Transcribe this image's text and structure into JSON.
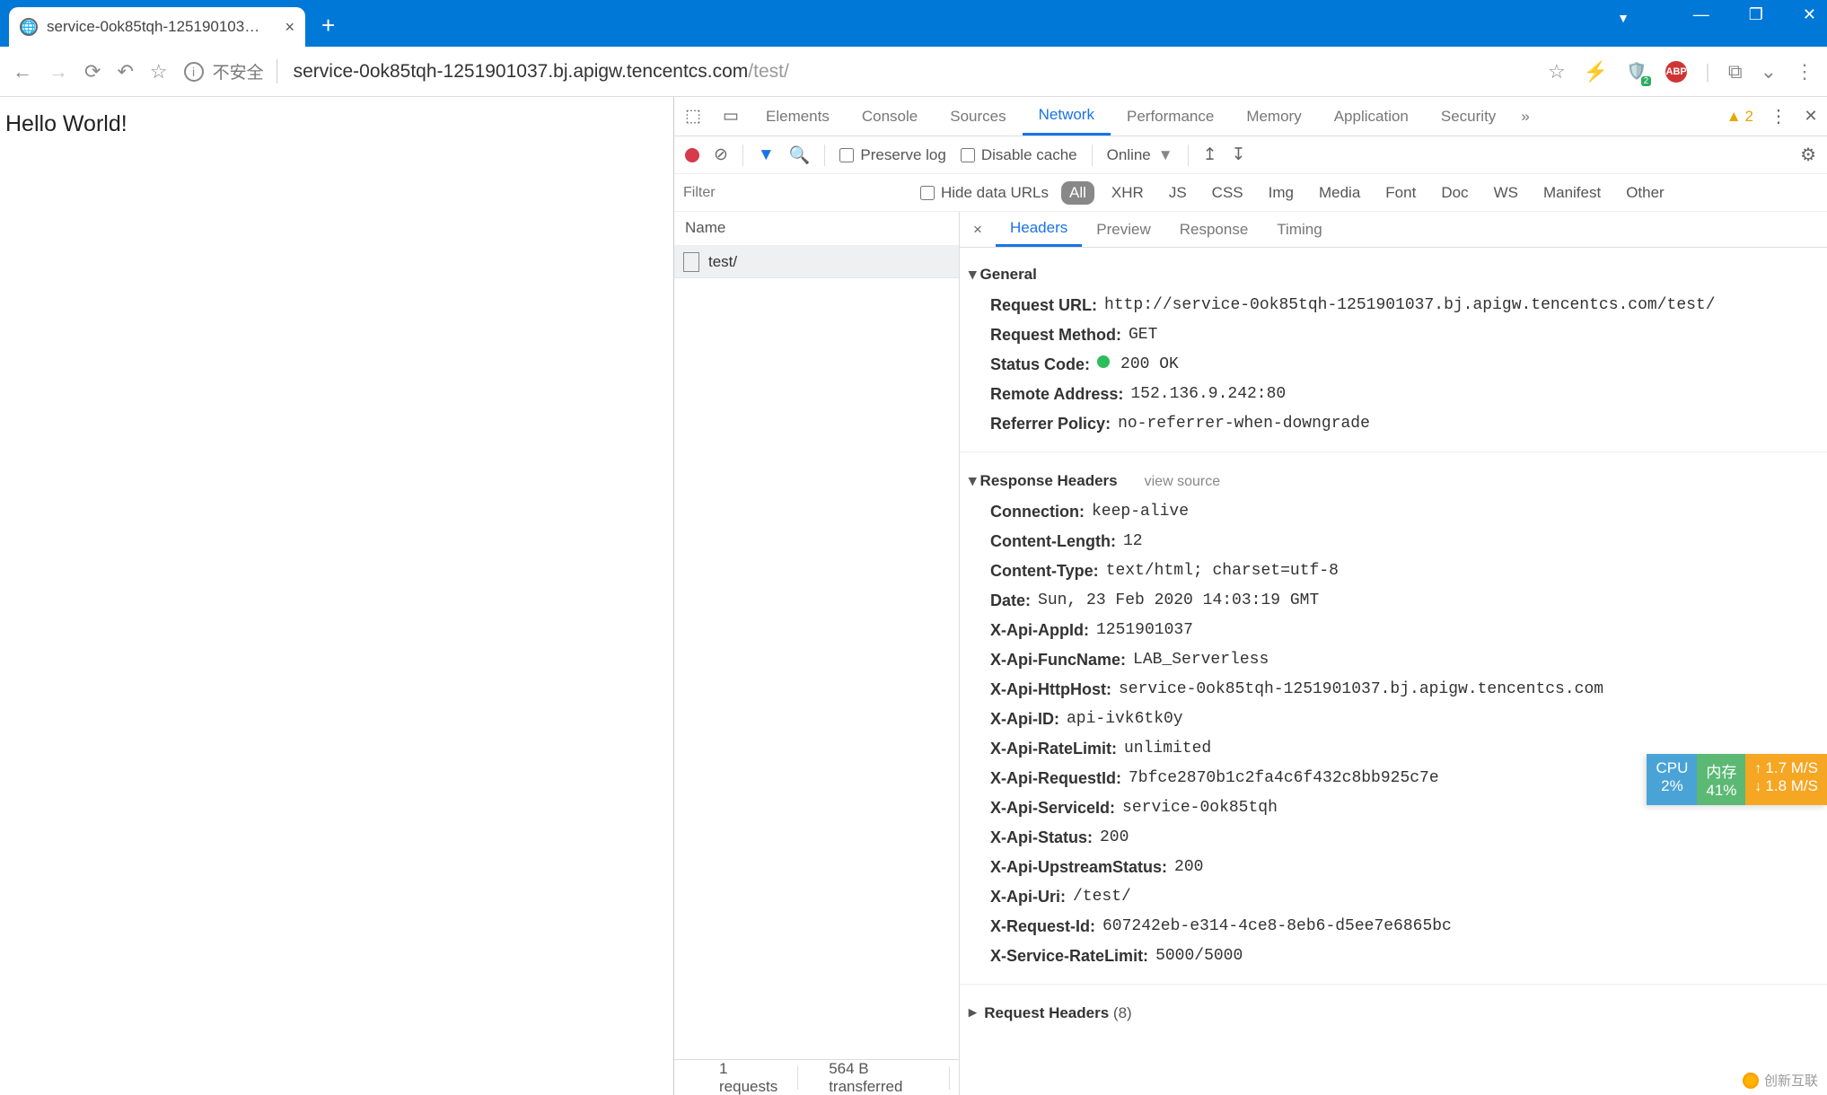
{
  "browser": {
    "tab_title": "service-0ok85tqh-125190103…",
    "insecure_label": "不安全",
    "url_host_path": "service-0ok85tqh-1251901037.bj.apigw.tencentcs.com",
    "url_tail": "/test/",
    "ext_badge": "2",
    "abp_label": "ABP"
  },
  "page": {
    "body_text": "Hello World!"
  },
  "devtools": {
    "tabs": [
      "Elements",
      "Console",
      "Sources",
      "Network",
      "Performance",
      "Memory",
      "Application",
      "Security"
    ],
    "active_tab": "Network",
    "warn_count": "2",
    "toolbar": {
      "preserve_log": "Preserve log",
      "disable_cache": "Disable cache",
      "throttle": "Online"
    },
    "filter": {
      "placeholder": "Filter",
      "hide_data_urls": "Hide data URLs",
      "types": [
        "All",
        "XHR",
        "JS",
        "CSS",
        "Img",
        "Media",
        "Font",
        "Doc",
        "WS",
        "Manifest",
        "Other"
      ]
    },
    "reqlist": {
      "header": "Name",
      "rows": [
        "test/"
      ]
    },
    "detail_tabs": [
      "Headers",
      "Preview",
      "Response",
      "Timing"
    ],
    "general_title": "General",
    "general": [
      {
        "k": "Request URL:",
        "v": "http://service-0ok85tqh-1251901037.bj.apigw.tencentcs.com/test/"
      },
      {
        "k": "Request Method:",
        "v": "GET"
      },
      {
        "k": "Status Code:",
        "v": "200 OK",
        "dot": true
      },
      {
        "k": "Remote Address:",
        "v": "152.136.9.242:80"
      },
      {
        "k": "Referrer Policy:",
        "v": "no-referrer-when-downgrade"
      }
    ],
    "response_headers_title": "Response Headers",
    "view_source": "view source",
    "response_headers": [
      {
        "k": "Connection:",
        "v": "keep-alive"
      },
      {
        "k": "Content-Length:",
        "v": "12"
      },
      {
        "k": "Content-Type:",
        "v": "text/html; charset=utf-8"
      },
      {
        "k": "Date:",
        "v": "Sun, 23 Feb 2020 14:03:19 GMT"
      },
      {
        "k": "X-Api-AppId:",
        "v": "1251901037"
      },
      {
        "k": "X-Api-FuncName:",
        "v": "LAB_Serverless"
      },
      {
        "k": "X-Api-HttpHost:",
        "v": "service-0ok85tqh-1251901037.bj.apigw.tencentcs.com"
      },
      {
        "k": "X-Api-ID:",
        "v": "api-ivk6tk0y"
      },
      {
        "k": "X-Api-RateLimit:",
        "v": "unlimited"
      },
      {
        "k": "X-Api-RequestId:",
        "v": "7bfce2870b1c2fa4c6f432c8bb925c7e"
      },
      {
        "k": "X-Api-ServiceId:",
        "v": "service-0ok85tqh"
      },
      {
        "k": "X-Api-Status:",
        "v": "200"
      },
      {
        "k": "X-Api-UpstreamStatus:",
        "v": "200"
      },
      {
        "k": "X-Api-Uri:",
        "v": "/test/"
      },
      {
        "k": "X-Request-Id:",
        "v": "607242eb-e314-4ce8-8eb6-d5ee7e6865bc"
      },
      {
        "k": "X-Service-RateLimit:",
        "v": "5000/5000"
      }
    ],
    "request_headers_title": "Request Headers",
    "request_headers_count": "(8)",
    "statusbar": {
      "requests": "1 requests",
      "transferred": "564 B transferred"
    }
  },
  "perf": {
    "cpu_label": "CPU",
    "cpu_val": "2%",
    "mem_label": "内存",
    "mem_val": "41%",
    "up": "1.7 M/S",
    "dn": "1.8 M/S"
  },
  "watermark": "创新互联"
}
